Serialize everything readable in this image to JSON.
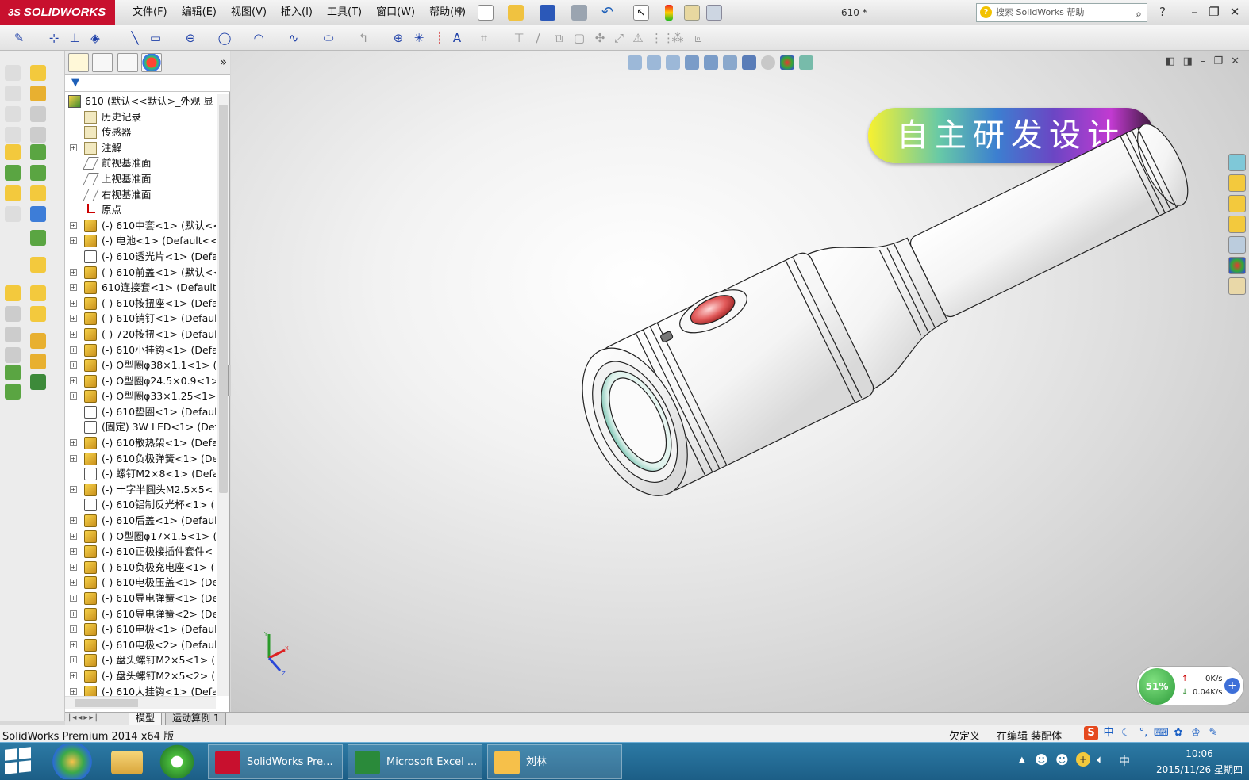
{
  "app": {
    "logo_text": "SOLIDWORKS",
    "logo_prefix": "3S",
    "document_title": "610 *",
    "help_search_placeholder": "搜索 SolidWorks 帮助"
  },
  "menu": [
    "文件(F)",
    "编辑(E)",
    "视图(V)",
    "插入(I)",
    "工具(T)",
    "窗口(W)",
    "帮助(H)"
  ],
  "tree": {
    "root": "610  (默认<<默认>_外观 显",
    "items": [
      {
        "label": "历史记录",
        "icon": "history-folder",
        "expand": false
      },
      {
        "label": "传感器",
        "icon": "sensor-folder",
        "expand": false
      },
      {
        "label": "注解",
        "icon": "annotation-folder",
        "expand": true
      },
      {
        "label": "前视基准面",
        "icon": "plane",
        "expand": false
      },
      {
        "label": "上视基准面",
        "icon": "plane",
        "expand": false
      },
      {
        "label": "右视基准面",
        "icon": "plane",
        "expand": false
      },
      {
        "label": "原点",
        "icon": "origin",
        "expand": false
      },
      {
        "label": "(-) 610中套<1> (默认<<",
        "icon": "part",
        "expand": true
      },
      {
        "label": "(-) 电池<1> (Default<<",
        "icon": "part",
        "expand": true
      },
      {
        "label": "(-) 610透光片<1> (Defa",
        "icon": "part-outline",
        "expand": false
      },
      {
        "label": "(-) 610前盖<1> (默认<<",
        "icon": "part",
        "expand": true
      },
      {
        "label": "610连接套<1> (Default",
        "icon": "part",
        "expand": true
      },
      {
        "label": "(-) 610按扭座<1> (Defa",
        "icon": "part",
        "expand": true
      },
      {
        "label": "(-) 610销钉<1> (Defaul",
        "icon": "part",
        "expand": true
      },
      {
        "label": "(-) 720按扭<1> (Defaul",
        "icon": "part",
        "expand": true
      },
      {
        "label": "(-) 610小挂钩<1> (Defa",
        "icon": "part",
        "expand": true
      },
      {
        "label": "(-) O型圈φ38×1.1<1> (",
        "icon": "part",
        "expand": true
      },
      {
        "label": "(-) O型圈φ24.5×0.9<1>",
        "icon": "part",
        "expand": true
      },
      {
        "label": "(-) O型圈φ33×1.25<1>",
        "icon": "part",
        "expand": true
      },
      {
        "label": "(-) 610垫圈<1> (Defaul",
        "icon": "part-outline",
        "expand": false
      },
      {
        "label": "(固定) 3W LED<1> (Def",
        "icon": "part-outline",
        "expand": false
      },
      {
        "label": "(-) 610散热架<1> (Defa",
        "icon": "part",
        "expand": true
      },
      {
        "label": "(-) 610负极弹簧<1> (De",
        "icon": "part",
        "expand": true
      },
      {
        "label": "(-) 螺钉M2×8<1> (Defa",
        "icon": "part-outline",
        "expand": false
      },
      {
        "label": "(-) 十字半圆头M2.5×5<",
        "icon": "part",
        "expand": true
      },
      {
        "label": "(-) 610铝制反光杯<1> (",
        "icon": "part-outline",
        "expand": false
      },
      {
        "label": "(-) 610后盖<1> (Defaul",
        "icon": "part",
        "expand": true
      },
      {
        "label": "(-) O型圈φ17×1.5<1> (",
        "icon": "part",
        "expand": true
      },
      {
        "label": "(-) 610正极接插件套件<",
        "icon": "part",
        "expand": true
      },
      {
        "label": "(-) 610负极充电座<1> (",
        "icon": "part",
        "expand": true
      },
      {
        "label": "(-) 610电极压盖<1> (De",
        "icon": "part",
        "expand": true
      },
      {
        "label": "(-) 610导电弹簧<1> (De",
        "icon": "part",
        "expand": true
      },
      {
        "label": "(-) 610导电弹簧<2> (De",
        "icon": "part",
        "expand": true
      },
      {
        "label": "(-) 610电极<1> (Defaul",
        "icon": "part",
        "expand": true
      },
      {
        "label": "(-) 610电极<2> (Defaul",
        "icon": "part",
        "expand": true
      },
      {
        "label": "(-) 盘头螺钉M2×5<1> (",
        "icon": "part",
        "expand": true
      },
      {
        "label": "(-) 盘头螺钉M2×5<2> (",
        "icon": "part",
        "expand": true
      },
      {
        "label": "(-) 610大挂钩<1> (Defa",
        "icon": "part",
        "expand": true
      }
    ]
  },
  "viewport": {
    "banner_text": "自主研发设计",
    "triad_labels": [
      "Y",
      "X",
      "Z"
    ]
  },
  "bottom_tabs": [
    "模型",
    "运动算例 1"
  ],
  "status": {
    "product": "SolidWorks Premium 2014 x64 版",
    "state1": "欠定义",
    "state2": "在编辑 装配体"
  },
  "net_meter": {
    "percent": "51%",
    "up": "0K/s",
    "down": "0.04K/s"
  },
  "taskbar": {
    "tasks": [
      {
        "label": "SolidWorks Pre..."
      },
      {
        "label": "Microsoft Excel ..."
      },
      {
        "label": "刘林"
      }
    ],
    "ime": "中",
    "time": "10:06",
    "date": "2015/11/26 星期四"
  },
  "colors": {
    "brand": "#c8102e",
    "taskbar": "#1c5e86"
  }
}
